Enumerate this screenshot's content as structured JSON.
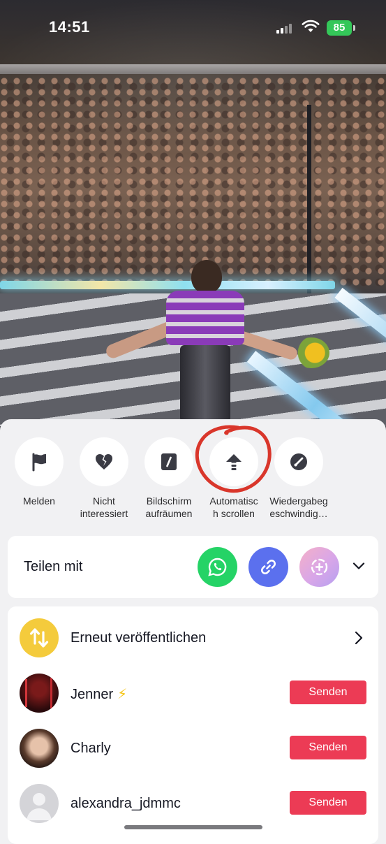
{
  "status_bar": {
    "time": "14:51",
    "battery": "85"
  },
  "actions": [
    {
      "label": "Melden",
      "icon": "flag-icon"
    },
    {
      "label": "Nicht\ninteressiert",
      "icon": "broken-heart-icon"
    },
    {
      "label": "Bildschirm\naufräumen",
      "icon": "clear-screen-icon"
    },
    {
      "label": "Automatisc\nh scrollen",
      "icon": "arrow-up-icon"
    },
    {
      "label": "Wiedergabeg\neschwindig…",
      "icon": "speedometer-icon"
    }
  ],
  "share": {
    "title": "Teilen mit",
    "apps": [
      {
        "icon": "whatsapp-icon",
        "color": "#25d366"
      },
      {
        "icon": "link-icon",
        "color": "#5b70ee"
      },
      {
        "icon": "story-plus-icon",
        "color": "#e9a6d6"
      }
    ]
  },
  "repost": {
    "label": "Erneut veröffentlichen",
    "icon": "repost-icon",
    "color": "#f4cb3c"
  },
  "contacts": [
    {
      "name": "Jenner",
      "badge": "⚡",
      "action": "Senden"
    },
    {
      "name": "Charly",
      "badge": "",
      "action": "Senden"
    },
    {
      "name": "alexandra_jdmmc",
      "badge": "",
      "action": "Senden"
    }
  ],
  "colors": {
    "accent_red": "#ec3b55",
    "annotation_red": "#d9362b"
  }
}
